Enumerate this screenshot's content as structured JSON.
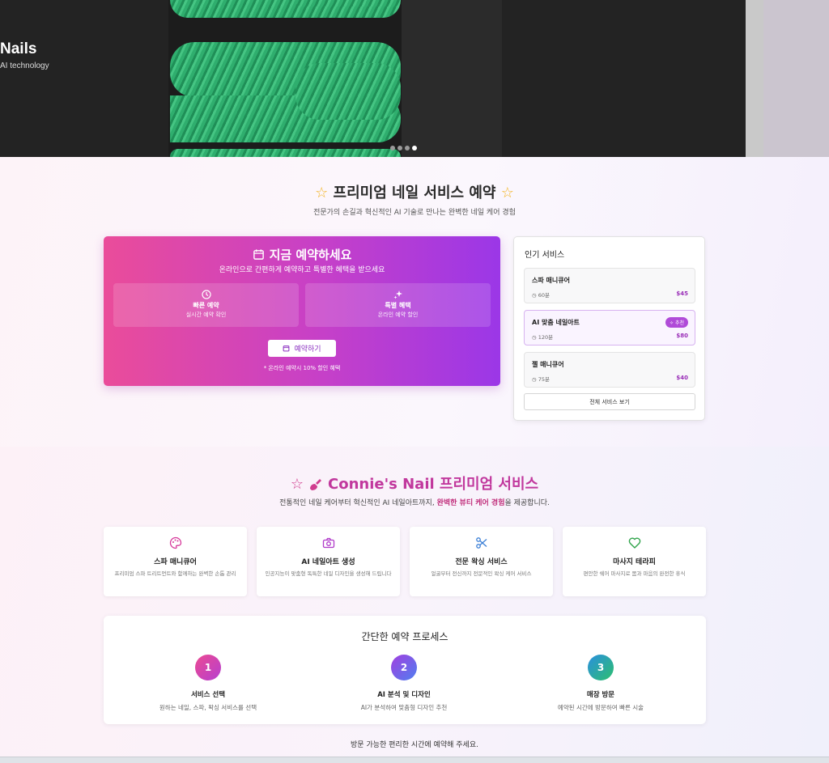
{
  "hero": {
    "title": "Nails",
    "subtitle": "AI technology",
    "slide_count": 4,
    "active_slide": 4
  },
  "booking": {
    "title": "프리미엄 네일 서비스 예약",
    "subtitle": "전문가의 손길과 혁신적인 AI 기술로 만나는 완벽한 네일 케어 경험",
    "card": {
      "title": "지금 예약하세요",
      "subtitle": "온라인으로 간편하게 예약하고 특별한 혜택을 받으세요",
      "features": [
        {
          "icon": "clock-icon",
          "title": "빠른 예약",
          "desc": "실시간 예약 확인"
        },
        {
          "icon": "sparkle-icon",
          "title": "특별 혜택",
          "desc": "온라인 예약 할인"
        }
      ],
      "button": "예약하기",
      "note": "* 온라인 예약시 10% 할인 혜택"
    },
    "popular": {
      "heading": "인기 서비스",
      "items": [
        {
          "name": "스파 매니큐어",
          "duration": "60분",
          "price": "$45",
          "badge": ""
        },
        {
          "name": "AI 맞춤 네일아트",
          "duration": "120분",
          "price": "$80",
          "badge": "추천"
        },
        {
          "name": "젤 매니큐어",
          "duration": "75분",
          "price": "$40",
          "badge": ""
        }
      ],
      "view_all": "전체 서비스 보기"
    }
  },
  "services": {
    "title": "Connie's Nail 프리미엄 서비스",
    "subtitle_pre": "전통적인 네일 케어부터 혁신적인 AI 네일아트까지, ",
    "subtitle_em": "완벽한 뷰티 케어 경험",
    "subtitle_post": "을 제공합니다.",
    "cards": [
      {
        "icon": "palette-icon",
        "title": "스파 매니큐어",
        "desc": "프리미엄 스파 트리트먼트와 함께하는 완벽한 손톱 관리",
        "color": "#d6389a"
      },
      {
        "icon": "camera-icon",
        "title": "AI 네일아트 생성",
        "desc": "인공지능이 맞춤형 독특한 네일 디자인을 생성해 드립니다",
        "color": "#b03ac9"
      },
      {
        "icon": "scissors-icon",
        "title": "전문 왁싱 서비스",
        "desc": "얼굴부터 전신까지 전문적인 왁싱 케어 서비스",
        "color": "#3b7fd6"
      },
      {
        "icon": "heart-icon",
        "title": "마사지 테라피",
        "desc": "편안한 쉐어 마사지로 몸과 마음의 완전한 휴식",
        "color": "#2fa34a"
      }
    ],
    "process": {
      "title": "간단한 예약 프로세스",
      "steps": [
        {
          "num": "1",
          "title": "서비스 선택",
          "desc": "원하는 네일, 스파, 왁싱 서비스를 선택",
          "gradient": [
            "#ec4a92",
            "#b63fd0"
          ]
        },
        {
          "num": "2",
          "title": "AI 분석 및 디자인",
          "desc": "AI가 분석하여 맞춤형 디자인 추천",
          "gradient": [
            "#a23fe0",
            "#4f7ff0"
          ]
        },
        {
          "num": "3",
          "title": "매장 방문",
          "desc": "예약된 시간에 방문하여 빠른 시술",
          "gradient": [
            "#2a8fe0",
            "#2dbf6e"
          ]
        }
      ]
    },
    "footer": "방문 가능한 편리한 시간에 예약해 주세요."
  },
  "colors": {
    "brand_pink": "#ea4c9a",
    "brand_purple": "#9b37e7",
    "price": "#9a2fb8",
    "star": "#f2b321"
  }
}
